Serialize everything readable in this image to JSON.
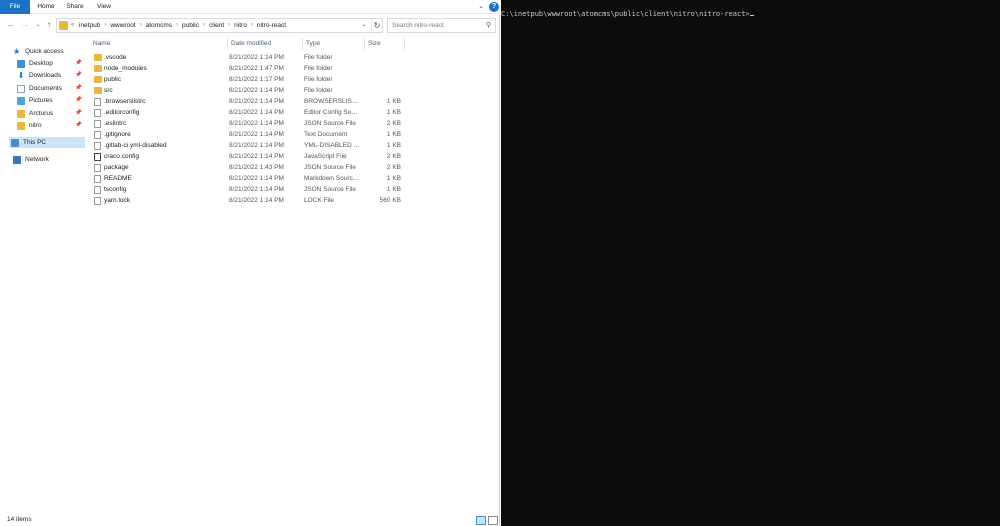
{
  "ribbon": {
    "tabs": [
      "File",
      "Home",
      "Share",
      "View"
    ],
    "help": "?"
  },
  "address": {
    "chevrons": "«",
    "crumbs": [
      "inetpub",
      "wwwroot",
      "atomcms",
      "public",
      "client",
      "nitro",
      "nitro-react"
    ],
    "separator": "›"
  },
  "search": {
    "placeholder": "Search nitro-react"
  },
  "sidebar": {
    "quick_access": "Quick access",
    "items": [
      "Desktop",
      "Downloads",
      "Documents",
      "Pictures",
      "Arcturus",
      "nitro"
    ],
    "this_pc": "This PC",
    "network": "Network"
  },
  "columns": {
    "name": "Name",
    "date": "Date modified",
    "type": "Type",
    "size": "Size"
  },
  "files": [
    {
      "name": ".vscode",
      "date": "8/21/2022 1:14 PM",
      "type": "File folder",
      "size": "",
      "icon": "folder"
    },
    {
      "name": "node_modules",
      "date": "8/21/2022 1:47 PM",
      "type": "File folder",
      "size": "",
      "icon": "folder"
    },
    {
      "name": "public",
      "date": "8/21/2022 1:17 PM",
      "type": "File folder",
      "size": "",
      "icon": "folder"
    },
    {
      "name": "src",
      "date": "8/21/2022 1:14 PM",
      "type": "File folder",
      "size": "",
      "icon": "folder"
    },
    {
      "name": ".browserslistrc",
      "date": "8/21/2022 1:14 PM",
      "type": "BROWSERSLISTRC ...",
      "size": "1 KB",
      "icon": "file"
    },
    {
      "name": ".editorconfig",
      "date": "8/21/2022 1:14 PM",
      "type": "Editor Config Sour...",
      "size": "1 KB",
      "icon": "file"
    },
    {
      "name": ".eslintrc",
      "date": "8/21/2022 1:14 PM",
      "type": "JSON Source File",
      "size": "2 KB",
      "icon": "file"
    },
    {
      "name": ".gitignore",
      "date": "8/21/2022 1:14 PM",
      "type": "Text Document",
      "size": "1 KB",
      "icon": "file"
    },
    {
      "name": ".gitlab-ci.yml-disabled",
      "date": "8/21/2022 1:14 PM",
      "type": "YML-DISABLED File",
      "size": "1 KB",
      "icon": "file"
    },
    {
      "name": "craco.config",
      "date": "8/21/2022 1:14 PM",
      "type": "JavaScript File",
      "size": "2 KB",
      "icon": "js"
    },
    {
      "name": "package",
      "date": "8/21/2022 1:43 PM",
      "type": "JSON Source File",
      "size": "2 KB",
      "icon": "file"
    },
    {
      "name": "README",
      "date": "8/21/2022 1:14 PM",
      "type": "Markdown Source...",
      "size": "1 KB",
      "icon": "file"
    },
    {
      "name": "tsconfig",
      "date": "8/21/2022 1:14 PM",
      "type": "JSON Source File",
      "size": "1 KB",
      "icon": "file"
    },
    {
      "name": "yarn.lock",
      "date": "8/21/2022 1:14 PM",
      "type": "LOCK File",
      "size": "560 KB",
      "icon": "file"
    }
  ],
  "status": {
    "count": "14 items"
  },
  "terminal": {
    "prompt": "C:\\inetpub\\wwwroot\\atomcms\\public\\client\\nitro\\nitro-react>"
  }
}
